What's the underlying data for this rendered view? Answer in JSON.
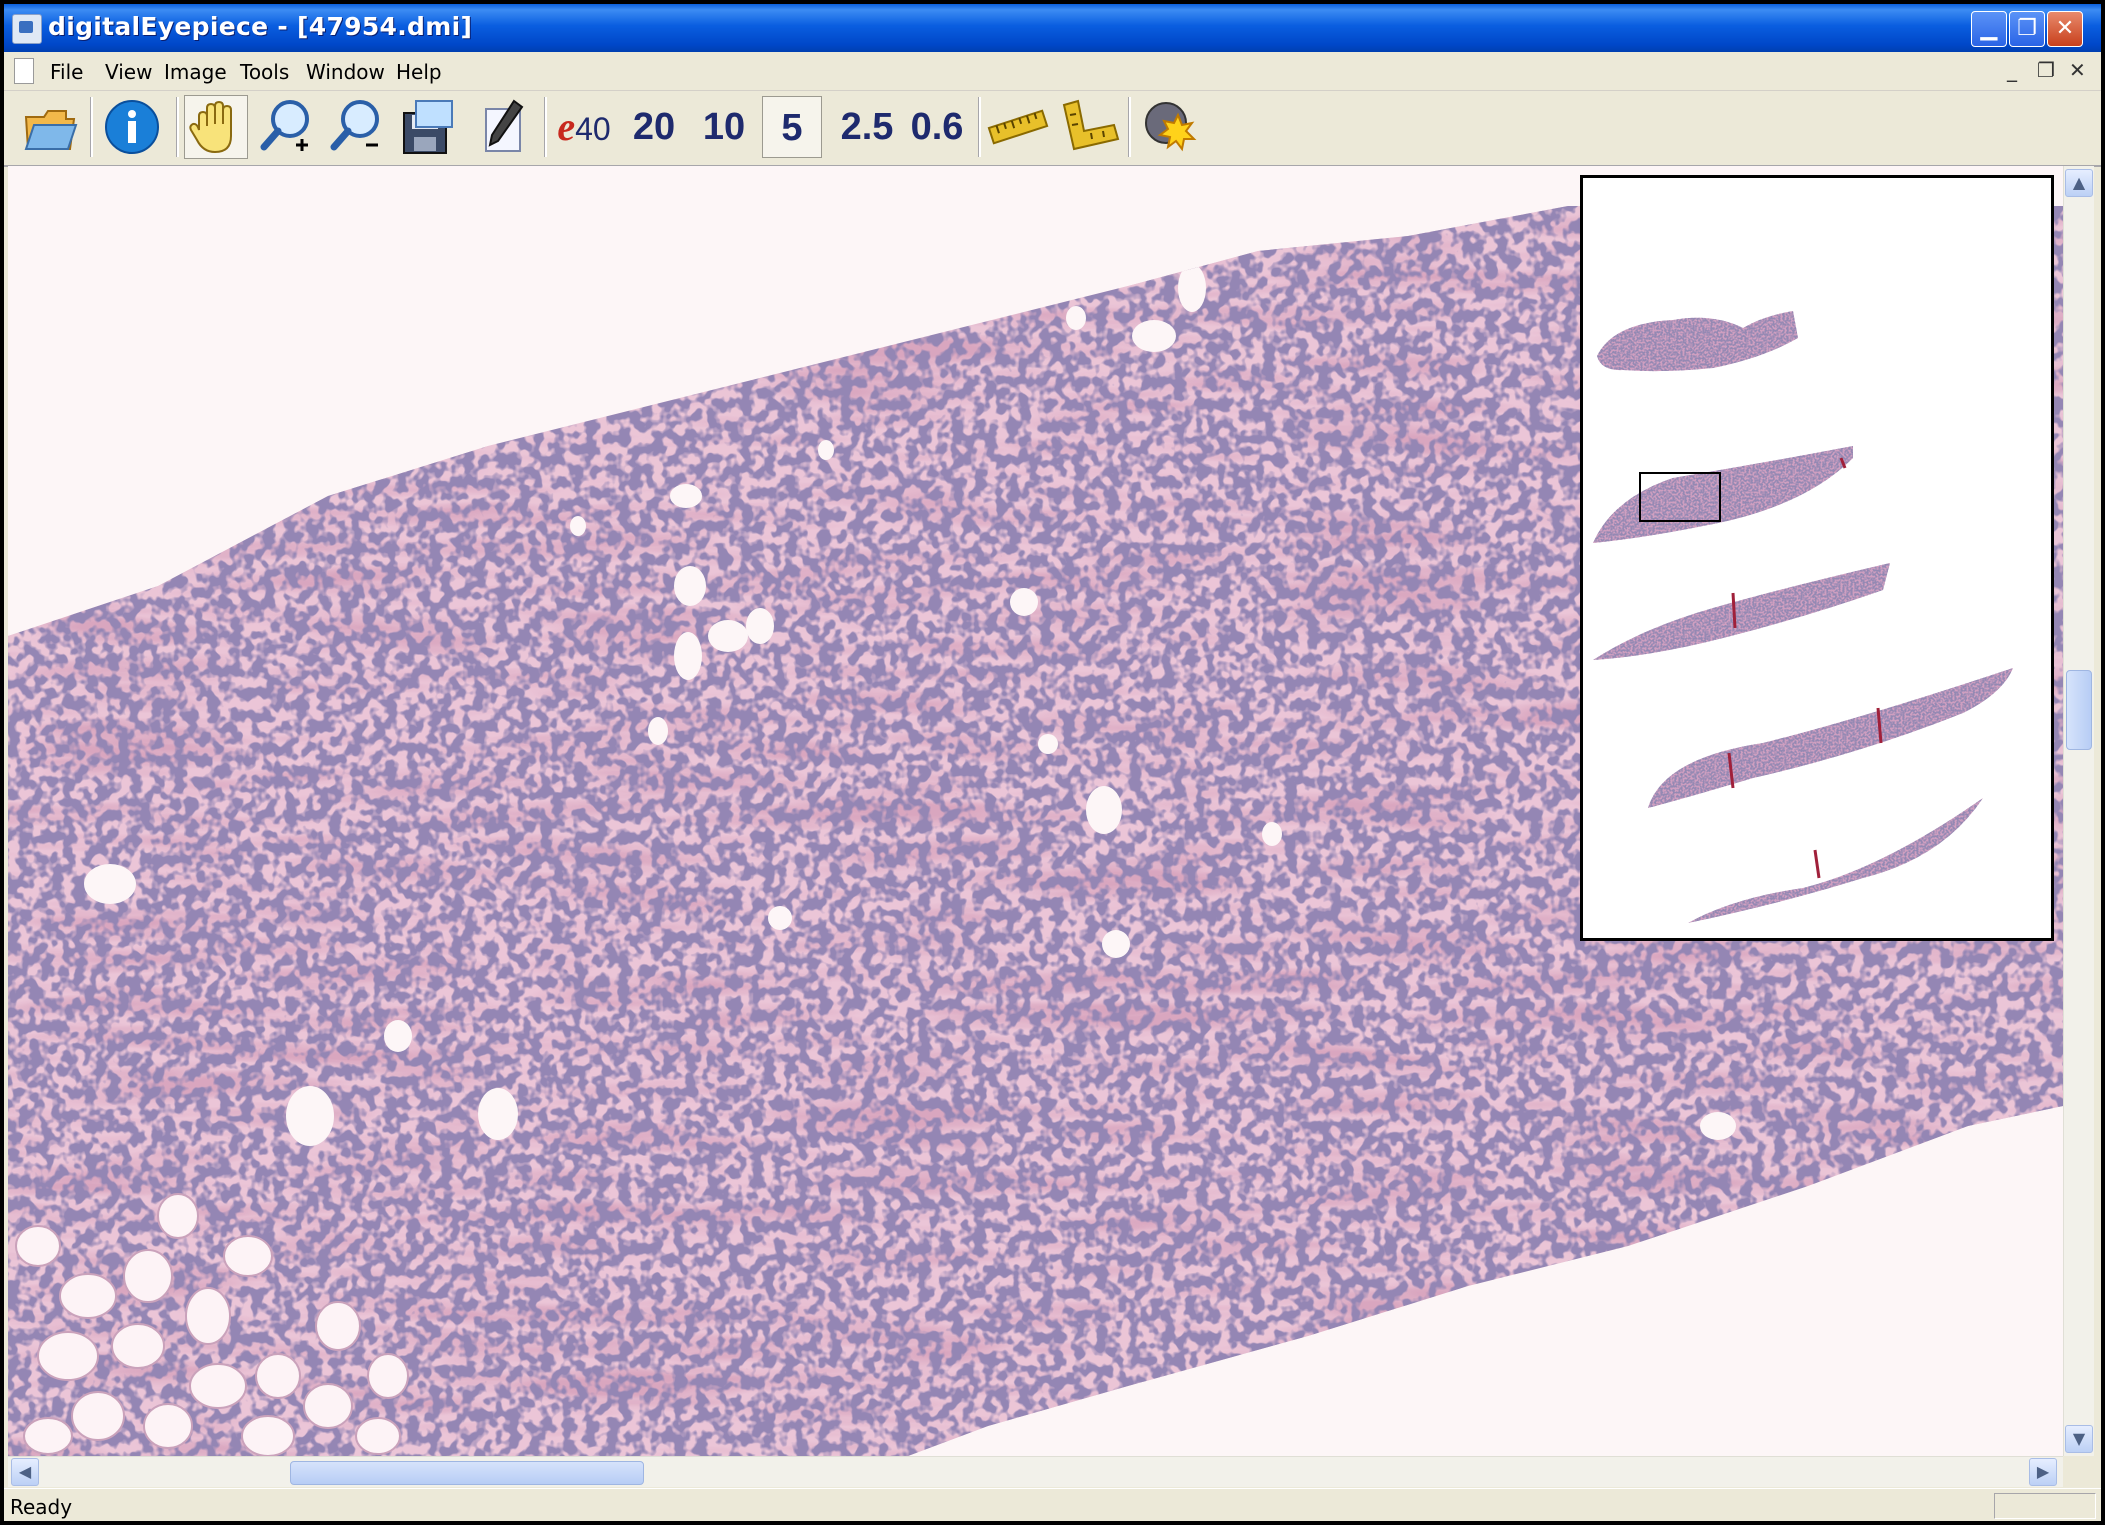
{
  "window": {
    "title": "digitalEyepiece - [47954.dmi]",
    "caption_buttons": {
      "minimize": "minimize-icon",
      "maximize": "maximize-icon",
      "close": "close-icon"
    }
  },
  "menu": {
    "items": [
      "File",
      "View",
      "Image",
      "Tools",
      "Window",
      "Help"
    ],
    "mdi_controls": [
      "_",
      "❐",
      "✕"
    ]
  },
  "toolbar": {
    "tools": [
      {
        "name": "open-folder-icon"
      },
      {
        "name": "info-icon"
      },
      {
        "name": "pan-hand-icon"
      },
      {
        "name": "zoom-in-icon"
      },
      {
        "name": "zoom-out-icon"
      },
      {
        "name": "save-icon"
      },
      {
        "name": "annotate-pen-icon"
      }
    ],
    "magnifications": {
      "e_prefix": "e",
      "e_value": "40",
      "levels": [
        "20",
        "10",
        "5",
        "2.5",
        "0.6"
      ],
      "selected": "5"
    },
    "measure_tools": [
      {
        "name": "ruler-icon"
      },
      {
        "name": "angle-ruler-icon"
      }
    ],
    "extra_tools": [
      {
        "name": "light-settings-icon"
      }
    ]
  },
  "overview": {
    "label": "slide-overview-thumbnail"
  },
  "colors": {
    "tissue_stroma": "#d9a6bf",
    "tissue_nuclei": "#4b3f78",
    "background": "#fdf6f7",
    "title_bar": "#0a5ee0"
  },
  "status": {
    "text": "Ready"
  }
}
